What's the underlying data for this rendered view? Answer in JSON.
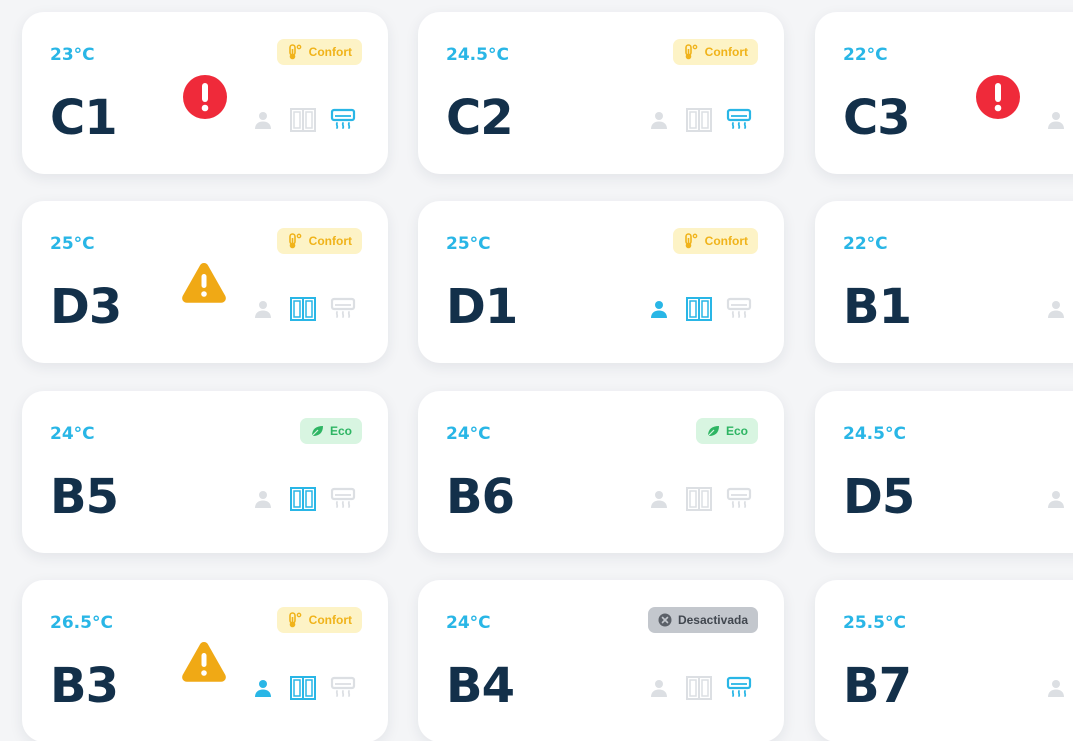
{
  "colors": {
    "active_icon": "#29b6e6",
    "inactive_icon": "#dcdfe3",
    "error": "#ef2a3a",
    "warning": "#f0a915"
  },
  "rooms": [
    {
      "temp": "23°C",
      "name": "C1",
      "badge": {
        "type": "confort",
        "label": "Confort"
      },
      "alert": "error",
      "occupancy": false,
      "window": false,
      "ac": true
    },
    {
      "temp": "24.5°C",
      "name": "C2",
      "badge": {
        "type": "confort",
        "label": "Confort"
      },
      "alert": null,
      "occupancy": false,
      "window": false,
      "ac": true
    },
    {
      "temp": "22°C",
      "name": "C3",
      "badge": {
        "type": "confort",
        "label": ""
      },
      "alert": "error",
      "occupancy": false,
      "window": false,
      "ac": false
    },
    {
      "temp": "25°C",
      "name": "D3",
      "badge": {
        "type": "confort",
        "label": "Confort"
      },
      "alert": "warning",
      "occupancy": false,
      "window": true,
      "ac": false
    },
    {
      "temp": "25°C",
      "name": "D1",
      "badge": {
        "type": "confort",
        "label": "Confort"
      },
      "alert": null,
      "occupancy": true,
      "window": true,
      "ac": false
    },
    {
      "temp": "22°C",
      "name": "B1",
      "badge": null,
      "alert": null,
      "occupancy": false,
      "window": false,
      "ac": false
    },
    {
      "temp": "24°C",
      "name": "B5",
      "badge": {
        "type": "eco",
        "label": "Eco"
      },
      "alert": null,
      "occupancy": false,
      "window": true,
      "ac": false
    },
    {
      "temp": "24°C",
      "name": "B6",
      "badge": {
        "type": "eco",
        "label": "Eco"
      },
      "alert": null,
      "occupancy": false,
      "window": false,
      "ac": false
    },
    {
      "temp": "24.5°C",
      "name": "D5",
      "badge": {
        "type": "confort",
        "label": ""
      },
      "alert": null,
      "occupancy": false,
      "window": false,
      "ac": false
    },
    {
      "temp": "26.5°C",
      "name": "B3",
      "badge": {
        "type": "confort",
        "label": "Confort"
      },
      "alert": "warning",
      "occupancy": true,
      "window": true,
      "ac": false
    },
    {
      "temp": "24°C",
      "name": "B4",
      "badge": {
        "type": "off",
        "label": "Desactivada"
      },
      "alert": null,
      "occupancy": false,
      "window": false,
      "ac": true
    },
    {
      "temp": "25.5°C",
      "name": "B7",
      "badge": {
        "type": "confort",
        "label": ""
      },
      "alert": null,
      "occupancy": false,
      "window": false,
      "ac": false
    }
  ]
}
